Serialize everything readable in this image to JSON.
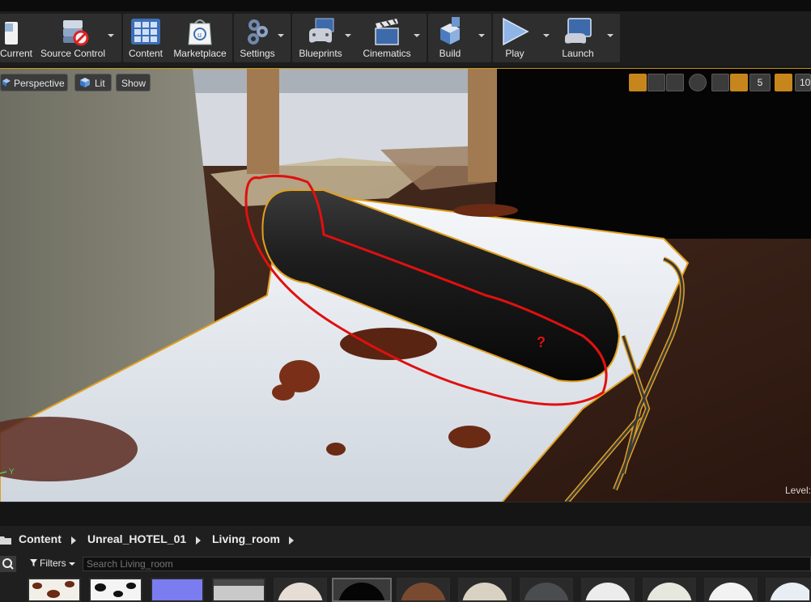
{
  "toolbar": {
    "buttons": [
      {
        "label": "Current",
        "icon": "save-icon"
      },
      {
        "label": "Source Control",
        "icon": "source-control-icon"
      },
      {
        "label": "Content",
        "icon": "content-icon"
      },
      {
        "label": "Marketplace",
        "icon": "marketplace-icon"
      },
      {
        "label": "Settings",
        "icon": "settings-icon"
      },
      {
        "label": "Blueprints",
        "icon": "blueprints-icon"
      },
      {
        "label": "Cinematics",
        "icon": "cinematics-icon"
      },
      {
        "label": "Build",
        "icon": "build-icon"
      },
      {
        "label": "Play",
        "icon": "play-icon"
      },
      {
        "label": "Launch",
        "icon": "launch-icon"
      }
    ]
  },
  "viewport": {
    "perspective_label": "Perspective",
    "lit_label": "Lit",
    "show_label": "Show",
    "grid_snap_value": "5",
    "rotation_snap_value": "10",
    "level_label": "Level:",
    "axis_label": "Y",
    "annotation_mark": "?",
    "accent_color": "#e0a020",
    "annotation_color": "#e01010"
  },
  "content_browser": {
    "breadcrumbs": [
      "Content",
      "Unreal_HOTEL_01",
      "Living_room"
    ],
    "filters_label": "Filters",
    "search_placeholder": "Search Living_room",
    "thumbnails": [
      "cowhide-pattern",
      "dalmatian-pattern",
      "normal-map",
      "grey-material",
      "cowhide-sphere",
      "black-leather-sphere",
      "wood-sphere",
      "cream-sphere",
      "dark-grey-sphere",
      "white-sphere",
      "off-white-sphere",
      "white-sphere-2",
      "white-sphere-3"
    ]
  }
}
